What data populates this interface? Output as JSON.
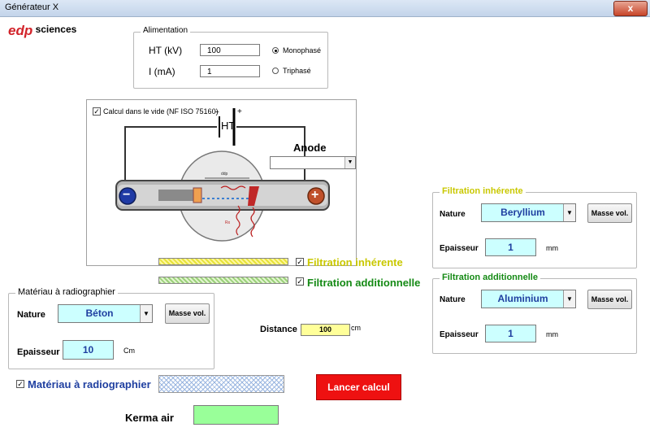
{
  "window": {
    "title": "Générateur X",
    "close_label": "x"
  },
  "logo": {
    "mark": "edp",
    "text": "sciences",
    "color": "#d2232a"
  },
  "alimentation": {
    "legend": "Alimentation",
    "ht_label": "HT (kV)",
    "ht_value": "100",
    "i_label": "I (mA)",
    "i_value": "1",
    "mono_label": "Monophasé",
    "tri_label": "Triphasé",
    "selected": "Monophasé"
  },
  "diagram": {
    "vacuum_label": "Calcul dans le vide (NF ISO 75160)",
    "vacuum_checked": true,
    "battery_minus": "−",
    "battery_plus": "+",
    "battery_label": "HT",
    "ddp_label": "ddp",
    "rx_label": "Rx",
    "cathode_symbol": "−",
    "anode_symbol": "+"
  },
  "anode": {
    "label": "Anode",
    "value": ""
  },
  "filtration_inherente": {
    "legend": "Filtration inhérente",
    "nature_label": "Nature",
    "nature_value": "Beryllium",
    "masse_button": "Masse vol.",
    "epaisseur_label": "Epaisseur",
    "epaisseur_value": "1",
    "unit": "mm",
    "check_label": "Filtration inhérente",
    "color": "#c9c800"
  },
  "filtration_additionnelle": {
    "legend": "Filtration additionnelle",
    "nature_label": "Nature",
    "nature_value": "Aluminium",
    "masse_button": "Masse vol.",
    "epaisseur_label": "Epaisseur",
    "epaisseur_value": "1",
    "unit": "mm",
    "check_label": "Filtration additionnelle",
    "color": "#158a15"
  },
  "materiau": {
    "legend": "Matériau à radiographier",
    "nature_label": "Nature",
    "nature_value": "Béton",
    "masse_button": "Masse vol.",
    "epaisseur_label": "Epaisseur",
    "epaisseur_value": "10",
    "unit": "Cm",
    "check_label": "Matériau à radiographier",
    "color": "#1f3fa0"
  },
  "distance": {
    "label": "Distance",
    "value": "100",
    "unit": "cm"
  },
  "launch_button": "Lancer calcul",
  "kerma": {
    "label": "Kerma air",
    "value": ""
  }
}
